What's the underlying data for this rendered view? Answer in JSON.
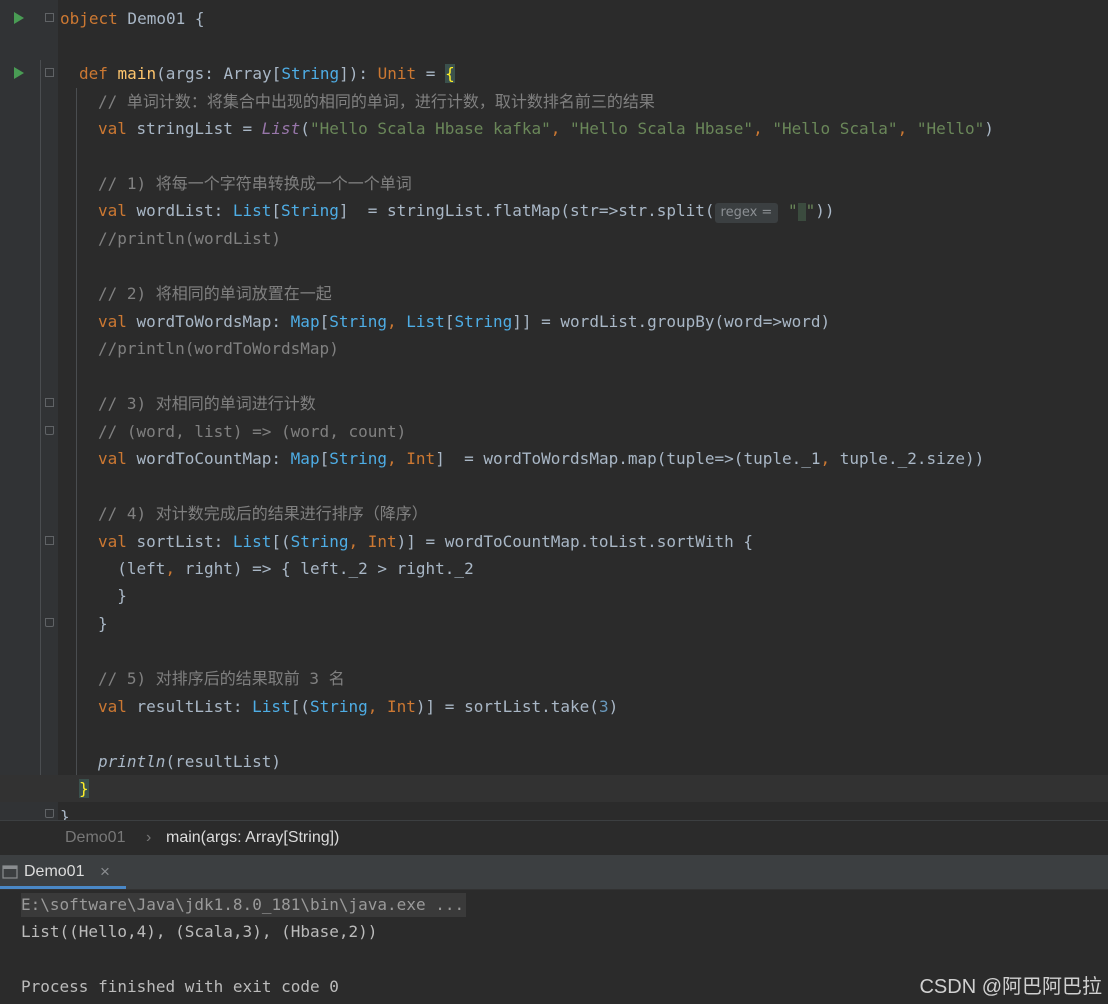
{
  "editor": {
    "lines": {
      "l1_kw": "object",
      "l1_rest": " Demo01 {",
      "l3_def": "def",
      "l3_main": "main",
      "l3_a": "(args: Array[",
      "l3_String": "String",
      "l3_b": "]): ",
      "l3_Unit": "Unit",
      "l3_c": " = ",
      "l3_brace": "{",
      "l4": "// 单词计数：将集合中出现的相同的单词，进行计数，取计数排名前三的结果",
      "l5_val": "val",
      "l5_a": " stringList = ",
      "l5_List": "List",
      "l5_b": "(",
      "l5_s1": "\"Hello Scala Hbase kafka\"",
      "l5_c1": ", ",
      "l5_s2": "\"Hello Scala Hbase\"",
      "l5_c2": ", ",
      "l5_s3": "\"Hello Scala\"",
      "l5_c3": ", ",
      "l5_s4": "\"Hello\"",
      "l5_end": ")",
      "l7": "// 1) 将每一个字符串转换成一个一个单词",
      "l8_val": "val",
      "l8_a": " wordList: ",
      "l8_List": "List",
      "l8_b": "[",
      "l8_String": "String",
      "l8_c": "]  = stringList.flatMap(str=>str.split(",
      "l8_hint": "regex =",
      "l8_q1": "\"",
      "l8_q2": "\"",
      "l8_end": "))",
      "l9": "//println(wordList)",
      "l11": "// 2) 将相同的单词放置在一起",
      "l12_val": "val",
      "l12_a": " wordToWordsMap: ",
      "l12_Map": "Map",
      "l12_b": "[",
      "l12_String": "String",
      "l12_c": ", ",
      "l12_List": "List",
      "l12_d": "[",
      "l12_String2": "String",
      "l12_e": "]] = wordList.groupBy(word=>word)",
      "l13": "//println(wordToWordsMap)",
      "l15": "// 3) 对相同的单词进行计数",
      "l16": "// (word, list) => (word, count)",
      "l17_val": "val",
      "l17_a": " wordToCountMap: ",
      "l17_Map": "Map",
      "l17_b": "[",
      "l17_String": "String",
      "l17_c": ", ",
      "l17_Int": "Int",
      "l17_d": "]  = wordToWordsMap.map(tuple=>(tuple._1",
      "l17_comma": ",",
      "l17_e": " tuple._2.size))",
      "l19": "// 4) 对计数完成后的结果进行排序（降序）",
      "l20_val": "val",
      "l20_a": " sortList: ",
      "l20_List": "List",
      "l20_b": "[(",
      "l20_String": "String",
      "l20_c": ", ",
      "l20_Int": "Int",
      "l20_d": ")] = wordToCountMap.toList.sortWith {",
      "l21_a": "  (left",
      "l21_comma": ",",
      "l21_b": " right) => { left._2 > right._2",
      "l22": "  }",
      "l23": "}",
      "l25": "// 5) 对排序后的结果取前 3 名",
      "l26_val": "val",
      "l26_a": " resultList: ",
      "l26_List": "List",
      "l26_b": "[(",
      "l26_String": "String",
      "l26_c": ", ",
      "l26_Int": "Int",
      "l26_d": ")] = sortList.take(",
      "l26_num": "3",
      "l26_end": ")",
      "l28_println": "println",
      "l28_rest": "(resultList)",
      "l29": "}",
      "l30": "}"
    }
  },
  "breadcrumb": {
    "item1": "Demo01",
    "sep": "›",
    "item2": "main(args: Array[String])"
  },
  "run_panel": {
    "tab_label": "Demo01",
    "close_glyph": "×"
  },
  "console": {
    "line1": "E:\\software\\Java\\jdk1.8.0_181\\bin\\java.exe ...",
    "line2": "List((Hello,4), (Scala,3), (Hbase,2))",
    "line3": "Process finished with exit code 0"
  },
  "watermark": "CSDN @阿巴阿巴拉",
  "colors": {
    "keyword": "#cc7832",
    "type": "#4eade5",
    "string": "#6a8759",
    "comment": "#808080",
    "function": "#ffc66d",
    "number": "#6897bb"
  },
  "icons": {
    "run": "run-gutter-icon",
    "fold": "fold-marker-icon",
    "panel": "run-panel-icon",
    "close": "close-icon"
  }
}
